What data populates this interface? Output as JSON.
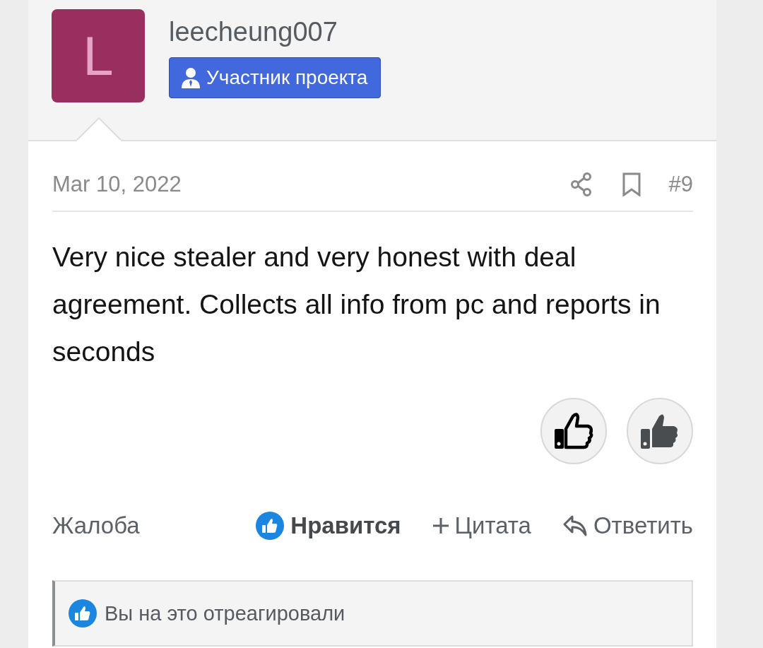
{
  "user": {
    "avatar_letter": "L",
    "name": "leecheung007",
    "badge": "Участник проекта"
  },
  "post": {
    "date": "Mar 10, 2022",
    "number": "#9",
    "body": "Very nice stealer and very honest with deal agreement. Collects all info from pc and reports in seconds"
  },
  "reaction_buttons": [
    {
      "kind": "outline"
    },
    {
      "kind": "filled"
    }
  ],
  "actions": [
    {
      "kind": "report",
      "label": "Жалоба",
      "active": false
    },
    {
      "kind": "like",
      "label": "Нравится",
      "active": true
    },
    {
      "kind": "quote",
      "label": "Цитата",
      "active": false
    },
    {
      "kind": "reply",
      "label": "Ответить",
      "active": false
    }
  ],
  "reaction_summary": "Вы на это отреагировали"
}
